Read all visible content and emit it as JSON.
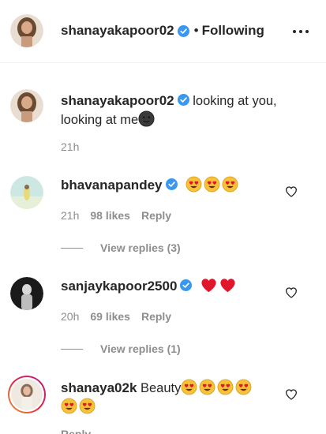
{
  "header": {
    "username": "shanayakapoor02",
    "separator": "•",
    "follow_status": "Following"
  },
  "caption": {
    "username": "shanayakapoor02",
    "text_line1": "looking at you,",
    "text_line2": "looking at me",
    "time": "21h"
  },
  "comments": [
    {
      "username": "bhavanapandey",
      "time": "21h",
      "likes": "98 likes",
      "reply_label": "Reply",
      "view_replies": "View replies (3)"
    },
    {
      "username": "sanjaykapoor2500",
      "time": "20h",
      "likes": "69 likes",
      "reply_label": "Reply",
      "view_replies": "View replies (1)"
    },
    {
      "username": "shanaya02k",
      "text": "Beauty",
      "reply_label": "Reply"
    }
  ],
  "icons": {
    "verified": "verified-badge-icon",
    "heart": "heart-outline-icon",
    "more": "more-options-icon",
    "face": "smiling-face-heart-eyes-emoji",
    "red_heart": "red-heart-emoji",
    "dark_face": "new-moon-face-emoji"
  },
  "colors": {
    "text": "#262626",
    "muted": "#8e8e8e",
    "verified_blue": "#3897f0",
    "emoji_yellow": "#f7c23a",
    "emoji_red": "#e0162b"
  }
}
